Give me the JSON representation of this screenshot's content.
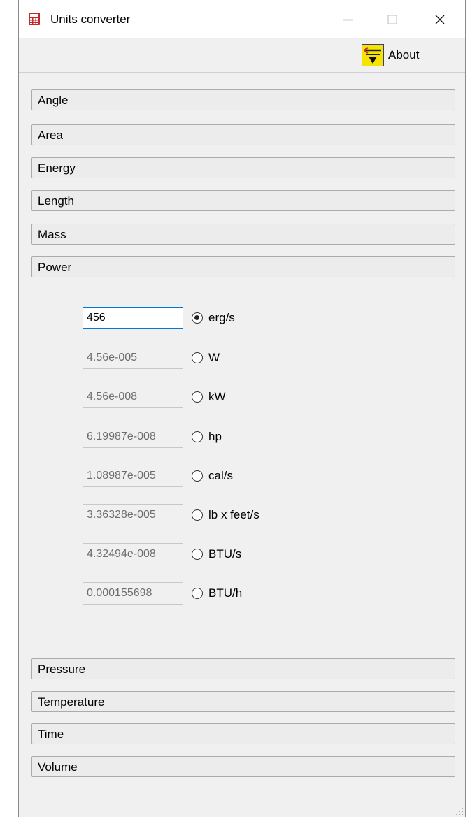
{
  "window": {
    "title": "Units converter"
  },
  "caption_buttons": {
    "minimize": "—",
    "maximize": "☐",
    "close": "✕"
  },
  "toolbar": {
    "about_label": "About"
  },
  "categories_top": [
    "Angle",
    "Area",
    "Energy",
    "Length",
    "Mass",
    "Power"
  ],
  "power": {
    "rows": [
      {
        "value": "456",
        "unit": "erg/s",
        "selected": true
      },
      {
        "value": "4.56e-005",
        "unit": "W",
        "selected": false
      },
      {
        "value": "4.56e-008",
        "unit": "kW",
        "selected": false
      },
      {
        "value": "6.19987e-008",
        "unit": "hp",
        "selected": false
      },
      {
        "value": "1.08987e-005",
        "unit": "cal/s",
        "selected": false
      },
      {
        "value": "3.36328e-005",
        "unit": "lb x feet/s",
        "selected": false
      },
      {
        "value": "4.32494e-008",
        "unit": "BTU/s",
        "selected": false
      },
      {
        "value": "0.000155698",
        "unit": "BTU/h",
        "selected": false
      }
    ]
  },
  "categories_bottom": [
    "Pressure",
    "Temperature",
    "Time",
    "Volume"
  ],
  "colors": {
    "accent": "#0078d7",
    "window_bg": "#f0f0f0",
    "disabled_text": "#6d6d6d"
  }
}
